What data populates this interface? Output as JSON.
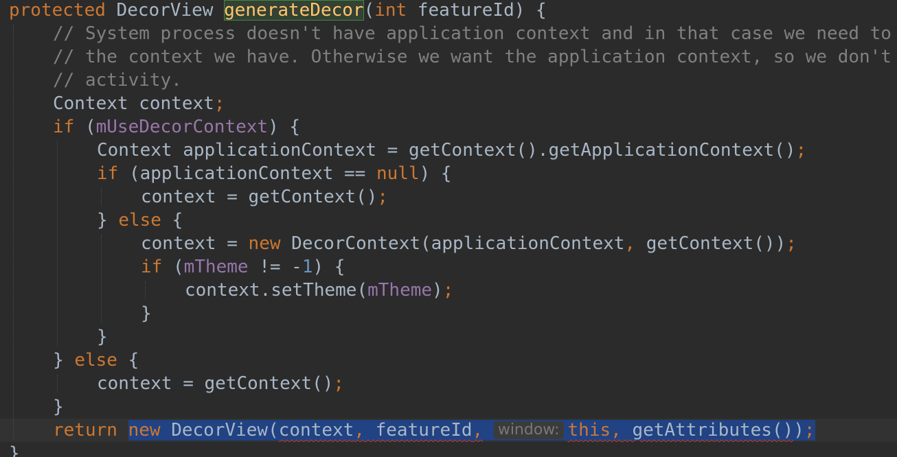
{
  "editor": {
    "colors": {
      "background": "#2b2b2b",
      "keyword": "#cc7832",
      "comment": "#808080",
      "field": "#9876aa",
      "number": "#6897bb",
      "plain": "#a9b7c6",
      "method_declaration": "#ffc66d",
      "selection": "#214283",
      "error_underline": "#bc3f3c"
    },
    "lines": [
      {
        "indent": 0,
        "current": false,
        "tokens": [
          {
            "text": "protected",
            "kind": "kw"
          },
          {
            "text": " DecorView ",
            "kind": "pl"
          },
          {
            "text": "generateDecor",
            "kind": "fn-decl"
          },
          {
            "text": "(",
            "kind": "pl"
          },
          {
            "text": "int",
            "kind": "kw"
          },
          {
            "text": " featureId) {",
            "kind": "pl"
          }
        ]
      },
      {
        "indent": 1,
        "current": false,
        "tokens": [
          {
            "text": "// System process doesn't have application context and in that case we need to directly use",
            "kind": "cm"
          }
        ]
      },
      {
        "indent": 1,
        "current": false,
        "tokens": [
          {
            "text": "// the context we have. Otherwise we want the application context, so we don't cling to the",
            "kind": "cm"
          }
        ]
      },
      {
        "indent": 1,
        "current": false,
        "tokens": [
          {
            "text": "// activity.",
            "kind": "cm"
          }
        ]
      },
      {
        "indent": 1,
        "current": false,
        "tokens": [
          {
            "text": "Context context",
            "kind": "pl"
          },
          {
            "text": ";",
            "kind": "kw"
          }
        ]
      },
      {
        "indent": 1,
        "current": false,
        "tokens": [
          {
            "text": "if",
            "kind": "kw"
          },
          {
            "text": " (",
            "kind": "pl"
          },
          {
            "text": "mUseDecorContext",
            "kind": "fld"
          },
          {
            "text": ") {",
            "kind": "pl"
          }
        ]
      },
      {
        "indent": 2,
        "current": false,
        "tokens": [
          {
            "text": "Context applicationContext = getContext().getApplicationContext()",
            "kind": "pl"
          },
          {
            "text": ";",
            "kind": "kw"
          }
        ]
      },
      {
        "indent": 2,
        "current": false,
        "tokens": [
          {
            "text": "if",
            "kind": "kw"
          },
          {
            "text": " (applicationContext == ",
            "kind": "pl"
          },
          {
            "text": "null",
            "kind": "kw"
          },
          {
            "text": ") {",
            "kind": "pl"
          }
        ]
      },
      {
        "indent": 3,
        "current": false,
        "tokens": [
          {
            "text": "context = getContext()",
            "kind": "pl"
          },
          {
            "text": ";",
            "kind": "kw"
          }
        ]
      },
      {
        "indent": 2,
        "current": false,
        "tokens": [
          {
            "text": "} ",
            "kind": "pl"
          },
          {
            "text": "else",
            "kind": "kw"
          },
          {
            "text": " {",
            "kind": "pl"
          }
        ]
      },
      {
        "indent": 3,
        "current": false,
        "tokens": [
          {
            "text": "context = ",
            "kind": "pl"
          },
          {
            "text": "new",
            "kind": "kw"
          },
          {
            "text": " DecorContext(applicationContext",
            "kind": "pl"
          },
          {
            "text": ",",
            "kind": "kw"
          },
          {
            "text": " getContext())",
            "kind": "pl"
          },
          {
            "text": ";",
            "kind": "kw"
          }
        ]
      },
      {
        "indent": 3,
        "current": false,
        "tokens": [
          {
            "text": "if",
            "kind": "kw"
          },
          {
            "text": " (",
            "kind": "pl"
          },
          {
            "text": "mTheme",
            "kind": "fld"
          },
          {
            "text": " != -",
            "kind": "pl"
          },
          {
            "text": "1",
            "kind": "num"
          },
          {
            "text": ") {",
            "kind": "pl"
          }
        ]
      },
      {
        "indent": 4,
        "current": false,
        "tokens": [
          {
            "text": "context.setTheme(",
            "kind": "pl"
          },
          {
            "text": "mTheme",
            "kind": "fld"
          },
          {
            "text": ")",
            "kind": "pl"
          },
          {
            "text": ";",
            "kind": "kw"
          }
        ]
      },
      {
        "indent": 3,
        "current": false,
        "tokens": [
          {
            "text": "}",
            "kind": "pl"
          }
        ]
      },
      {
        "indent": 2,
        "current": false,
        "tokens": [
          {
            "text": "}",
            "kind": "pl"
          }
        ]
      },
      {
        "indent": 1,
        "current": false,
        "tokens": [
          {
            "text": "} ",
            "kind": "pl"
          },
          {
            "text": "else",
            "kind": "kw"
          },
          {
            "text": " {",
            "kind": "pl"
          }
        ]
      },
      {
        "indent": 2,
        "current": false,
        "tokens": [
          {
            "text": "context = getContext()",
            "kind": "pl"
          },
          {
            "text": ";",
            "kind": "kw"
          }
        ]
      },
      {
        "indent": 1,
        "current": false,
        "tokens": [
          {
            "text": "}",
            "kind": "pl"
          }
        ]
      },
      {
        "indent": 1,
        "current": true,
        "tokens": [
          {
            "text": "return",
            "kind": "kw"
          },
          {
            "text": " ",
            "kind": "pl"
          },
          {
            "text": "new",
            "kind": "kw",
            "sel": true
          },
          {
            "text": " DecorView(",
            "kind": "pl",
            "sel": true
          },
          {
            "text": "context",
            "kind": "pl",
            "sel": true,
            "squiggle": true
          },
          {
            "text": ",",
            "kind": "kw",
            "sel": true,
            "squiggle": true
          },
          {
            "text": " featureId",
            "kind": "pl",
            "sel": true,
            "squiggle": true
          },
          {
            "text": ",",
            "kind": "kw",
            "sel": true,
            "squiggle": true
          },
          {
            "text": " ",
            "kind": "pl",
            "sel": true
          },
          {
            "text": "window:",
            "kind": "hint",
            "sel": true
          },
          {
            "text": "this",
            "kind": "kw",
            "sel": true,
            "squiggle": true
          },
          {
            "text": ",",
            "kind": "kw",
            "sel": true,
            "squiggle": true
          },
          {
            "text": " getAttributes()",
            "kind": "pl",
            "sel": true,
            "squiggle": true
          },
          {
            "text": ")",
            "kind": "pl",
            "sel": true
          },
          {
            "text": ";",
            "kind": "kw",
            "sel": true
          }
        ]
      },
      {
        "indent": 0,
        "current": false,
        "tokens": [
          {
            "text": "}",
            "kind": "pl"
          }
        ]
      }
    ]
  }
}
